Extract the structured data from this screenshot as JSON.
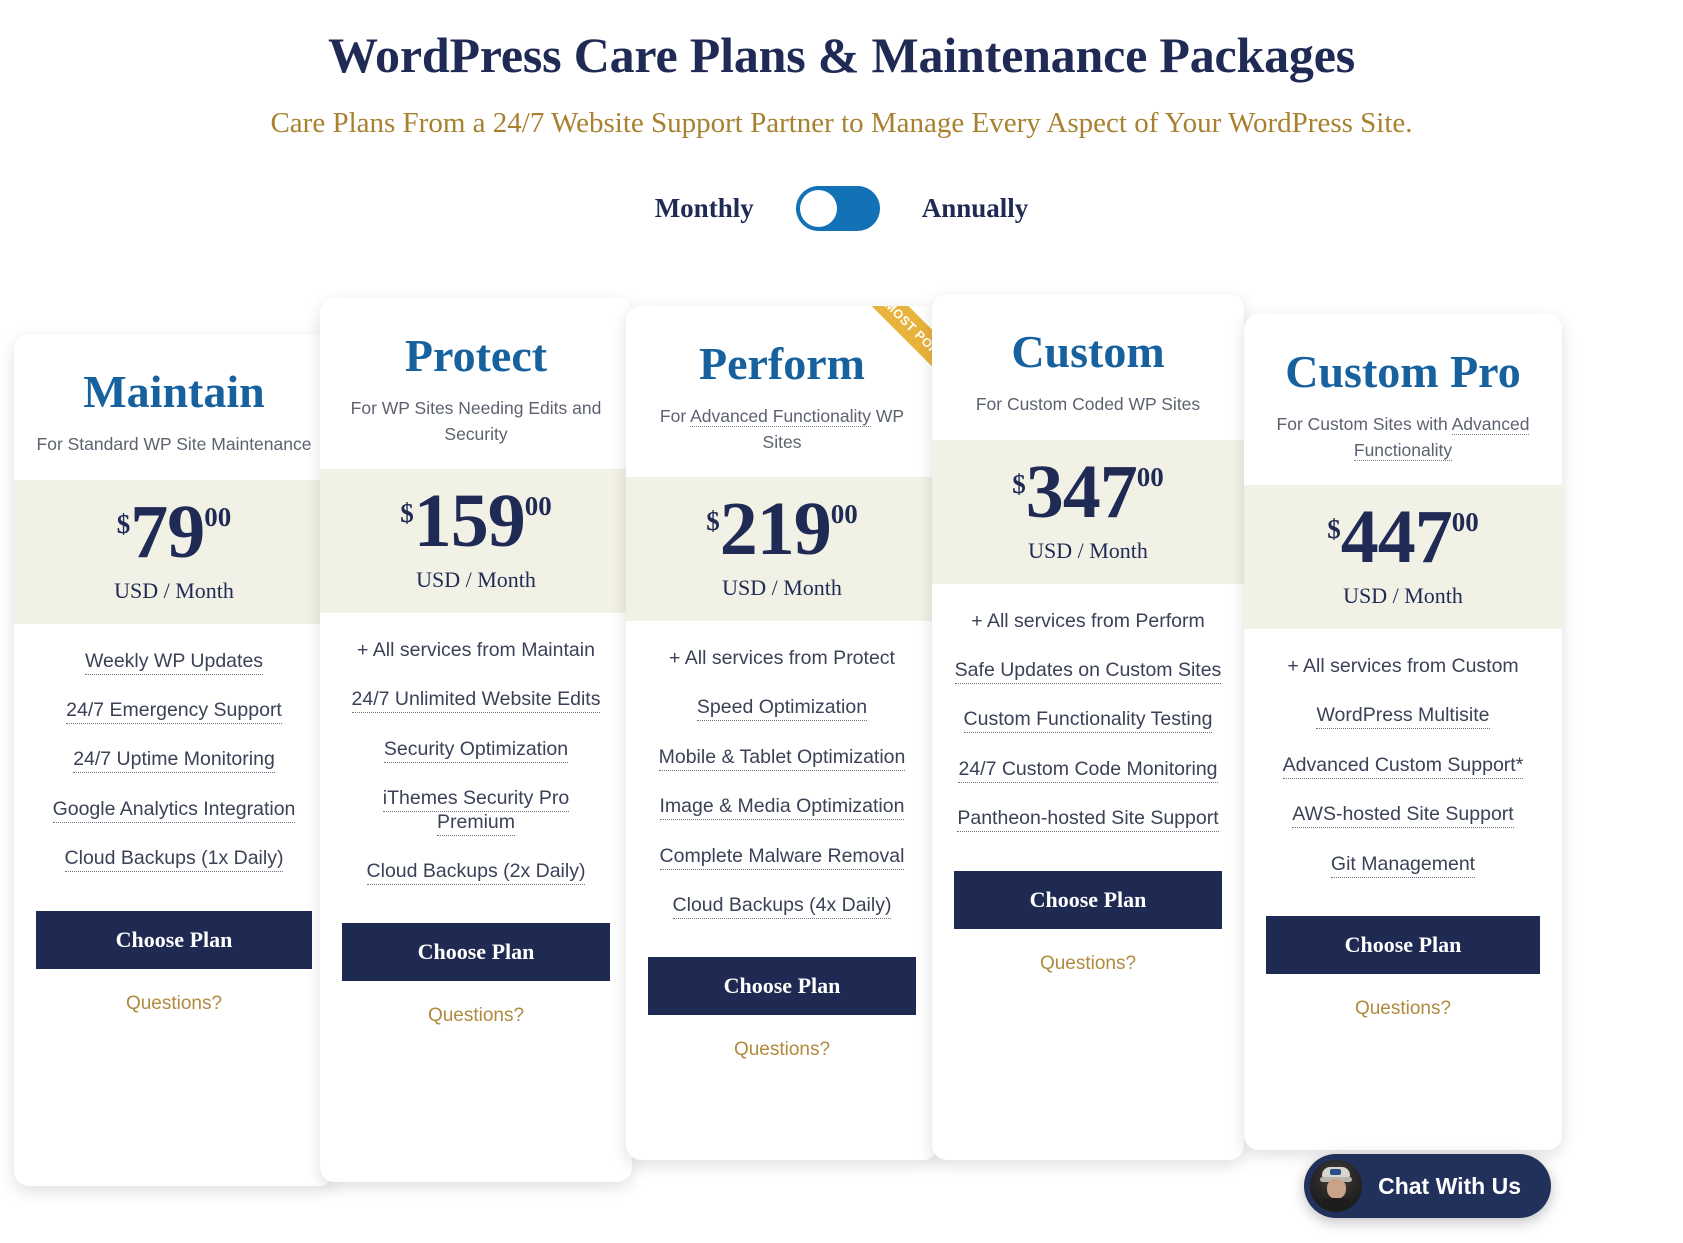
{
  "hero": {
    "title": "WordPress Care Plans & Maintenance Packages",
    "subtitle": "Care Plans From a 24/7 Website Support Partner to Manage Every Aspect of Your WordPress Site."
  },
  "billing_toggle": {
    "left_label": "Monthly",
    "right_label": "Annually",
    "selected": "Monthly",
    "knob_position": "left",
    "track_color": "#1372b5",
    "knob_color": "#ffffff"
  },
  "colors": {
    "heading_navy": "#1f2a55",
    "subtitle_gold": "#a8812f",
    "plan_name_blue": "#16619e",
    "price_band": "#f2f1e6",
    "cta_navy": "#1e2a52",
    "ribbon_gold": "#e8b33c",
    "questions_gold": "#b08a3d",
    "chat_navy": "#22305c"
  },
  "common": {
    "cta_label": "Choose Plan",
    "questions_label": "Questions?",
    "currency_symbol": "$",
    "cents": "00",
    "period": "USD / Month"
  },
  "plans": [
    {
      "name": "Maintain",
      "desc_prefix": "For Standard WP Site Maintenance",
      "desc_dotted": "",
      "desc_suffix": "",
      "price": "79",
      "cents": "00",
      "currency": "$",
      "period": "USD / Month",
      "ribbon": "",
      "features": [
        {
          "text": "Weekly WP Updates",
          "dotted": true
        },
        {
          "text": "24/7 Emergency Support",
          "dotted": true
        },
        {
          "text": "24/7 Uptime Monitoring",
          "dotted": true
        },
        {
          "text": "Google Analytics Integration",
          "dotted": true
        },
        {
          "text": "Cloud Backups (1x Daily)",
          "dotted": true
        }
      ],
      "cta_label": "Choose Plan",
      "questions_label": "Questions?"
    },
    {
      "name": "Protect",
      "desc_prefix": "For WP Sites Needing Edits and Security",
      "desc_dotted": "",
      "desc_suffix": "",
      "price": "159",
      "cents": "00",
      "currency": "$",
      "period": "USD / Month",
      "ribbon": "",
      "features": [
        {
          "text": "+ All services from Maintain",
          "dotted": false
        },
        {
          "text": "24/7 Unlimited Website Edits",
          "dotted": true
        },
        {
          "text": "Security Optimization",
          "dotted": true
        },
        {
          "text": "iThemes Security Pro Premium",
          "dotted": true
        },
        {
          "text": "Cloud Backups (2x Daily)",
          "dotted": true
        }
      ],
      "cta_label": "Choose Plan",
      "questions_label": "Questions?"
    },
    {
      "name": "Perform",
      "desc_prefix": "For ",
      "desc_dotted": "Advanced Functionality",
      "desc_suffix": " WP Sites",
      "price": "219",
      "cents": "00",
      "currency": "$",
      "period": "USD / Month",
      "ribbon": "MOST POPULAR",
      "features": [
        {
          "text": "+ All services from Protect",
          "dotted": false
        },
        {
          "text": "Speed Optimization",
          "dotted": true
        },
        {
          "text": "Mobile & Tablet Optimization",
          "dotted": true
        },
        {
          "text": "Image & Media Optimization",
          "dotted": true
        },
        {
          "text": "Complete Malware Removal",
          "dotted": true
        },
        {
          "text": "Cloud Backups (4x Daily)",
          "dotted": true
        }
      ],
      "cta_label": "Choose Plan",
      "questions_label": "Questions?"
    },
    {
      "name": "Custom",
      "desc_prefix": "For Custom Coded WP Sites",
      "desc_dotted": "",
      "desc_suffix": "",
      "price": "347",
      "cents": "00",
      "currency": "$",
      "period": "USD / Month",
      "ribbon": "",
      "features": [
        {
          "text": "+ All services from Perform",
          "dotted": false
        },
        {
          "text": "Safe Updates on Custom Sites",
          "dotted": true
        },
        {
          "text": "Custom Functionality Testing",
          "dotted": true
        },
        {
          "text": "24/7 Custom Code Monitoring",
          "dotted": true
        },
        {
          "text": "Pantheon-hosted Site Support",
          "dotted": true
        }
      ],
      "cta_label": "Choose Plan",
      "questions_label": "Questions?"
    },
    {
      "name": "Custom Pro",
      "desc_prefix": "For Custom Sites with ",
      "desc_dotted": "Advanced Functionality",
      "desc_suffix": "",
      "price": "447",
      "cents": "00",
      "currency": "$",
      "period": "USD / Month",
      "ribbon": "",
      "features": [
        {
          "text": "+ All services from Custom",
          "dotted": false
        },
        {
          "text": "WordPress Multisite",
          "dotted": true
        },
        {
          "text": "Advanced Custom Support*",
          "dotted": true
        },
        {
          "text": "AWS-hosted Site Support",
          "dotted": true
        },
        {
          "text": "Git Management",
          "dotted": true
        }
      ],
      "cta_label": "Choose Plan",
      "questions_label": "Questions?"
    }
  ],
  "chat_widget": {
    "label": "Chat With Us",
    "avatar": "agent-photo"
  }
}
